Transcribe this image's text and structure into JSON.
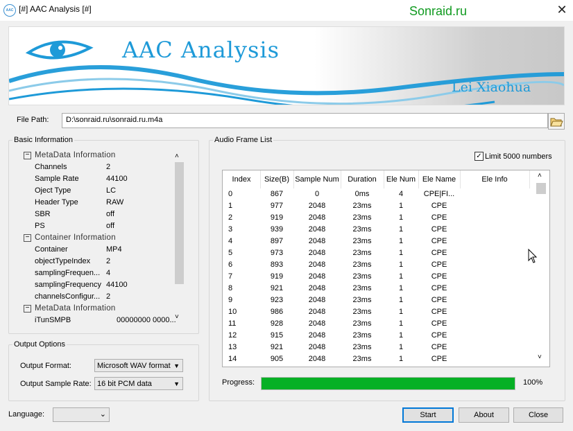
{
  "window": {
    "title": "[#] AAC Analysis [#]",
    "icon_text": "AAC",
    "watermark": "Sonraid.ru",
    "close_glyph": "✕"
  },
  "banner": {
    "title": "AAC Analysis",
    "author": "Lei Xiaohua"
  },
  "file": {
    "label": "File Path:",
    "value": "D:\\sonraid.ru\\sonraid.ru.m4a"
  },
  "basic": {
    "label": "Basic Information",
    "sections": [
      {
        "title": "MetaData Information",
        "items": [
          {
            "key": "Channels",
            "val": "2"
          },
          {
            "key": "Sample Rate",
            "val": "44100"
          },
          {
            "key": "Oject Type",
            "val": "LC"
          },
          {
            "key": "Header Type",
            "val": "RAW"
          },
          {
            "key": "SBR",
            "val": "off"
          },
          {
            "key": "PS",
            "val": "off"
          }
        ]
      },
      {
        "title": "Container Information",
        "items": [
          {
            "key": "Container",
            "val": "MP4"
          },
          {
            "key": "objectTypeIndex",
            "val": "2"
          },
          {
            "key": "samplingFrequen...",
            "val": "4"
          },
          {
            "key": "samplingFrequency",
            "val": "44100"
          },
          {
            "key": "channelsConfigur...",
            "val": "2"
          }
        ]
      },
      {
        "title": "MetaData Information",
        "items": [
          {
            "key": "iTunSMPB",
            "val": "00000000 0000..."
          }
        ]
      }
    ]
  },
  "output": {
    "label": "Output Options",
    "format_label": "Output Format:",
    "format_value": "Microsoft WAV format",
    "rate_label": "Output Sample Rate:",
    "rate_value": "16 bit PCM data"
  },
  "frames": {
    "label": "Audio Frame List",
    "limit_label": "Limit 5000 numbers",
    "limit_checked": true,
    "columns": [
      "Index",
      "Size(B)",
      "Sample Num",
      "Duration",
      "Ele Num",
      "Ele Name",
      "Ele Info"
    ],
    "rows": [
      [
        "0",
        "867",
        "0",
        "0ms",
        "4",
        "CPE|FI...",
        ""
      ],
      [
        "1",
        "977",
        "2048",
        "23ms",
        "1",
        "CPE",
        ""
      ],
      [
        "2",
        "919",
        "2048",
        "23ms",
        "1",
        "CPE",
        ""
      ],
      [
        "3",
        "939",
        "2048",
        "23ms",
        "1",
        "CPE",
        ""
      ],
      [
        "4",
        "897",
        "2048",
        "23ms",
        "1",
        "CPE",
        ""
      ],
      [
        "5",
        "973",
        "2048",
        "23ms",
        "1",
        "CPE",
        ""
      ],
      [
        "6",
        "893",
        "2048",
        "23ms",
        "1",
        "CPE",
        ""
      ],
      [
        "7",
        "919",
        "2048",
        "23ms",
        "1",
        "CPE",
        ""
      ],
      [
        "8",
        "921",
        "2048",
        "23ms",
        "1",
        "CPE",
        ""
      ],
      [
        "9",
        "923",
        "2048",
        "23ms",
        "1",
        "CPE",
        ""
      ],
      [
        "10",
        "986",
        "2048",
        "23ms",
        "1",
        "CPE",
        ""
      ],
      [
        "11",
        "928",
        "2048",
        "23ms",
        "1",
        "CPE",
        ""
      ],
      [
        "12",
        "915",
        "2048",
        "23ms",
        "1",
        "CPE",
        ""
      ],
      [
        "13",
        "921",
        "2048",
        "23ms",
        "1",
        "CPE",
        ""
      ],
      [
        "14",
        "905",
        "2048",
        "23ms",
        "1",
        "CPE",
        ""
      ]
    ]
  },
  "progress": {
    "label": "Progress:",
    "percent": 100,
    "percent_text": "100%",
    "color": "#06b025"
  },
  "bottom": {
    "language_label": "Language:",
    "start_label": "Start",
    "about_label": "About",
    "close_label": "Close"
  }
}
